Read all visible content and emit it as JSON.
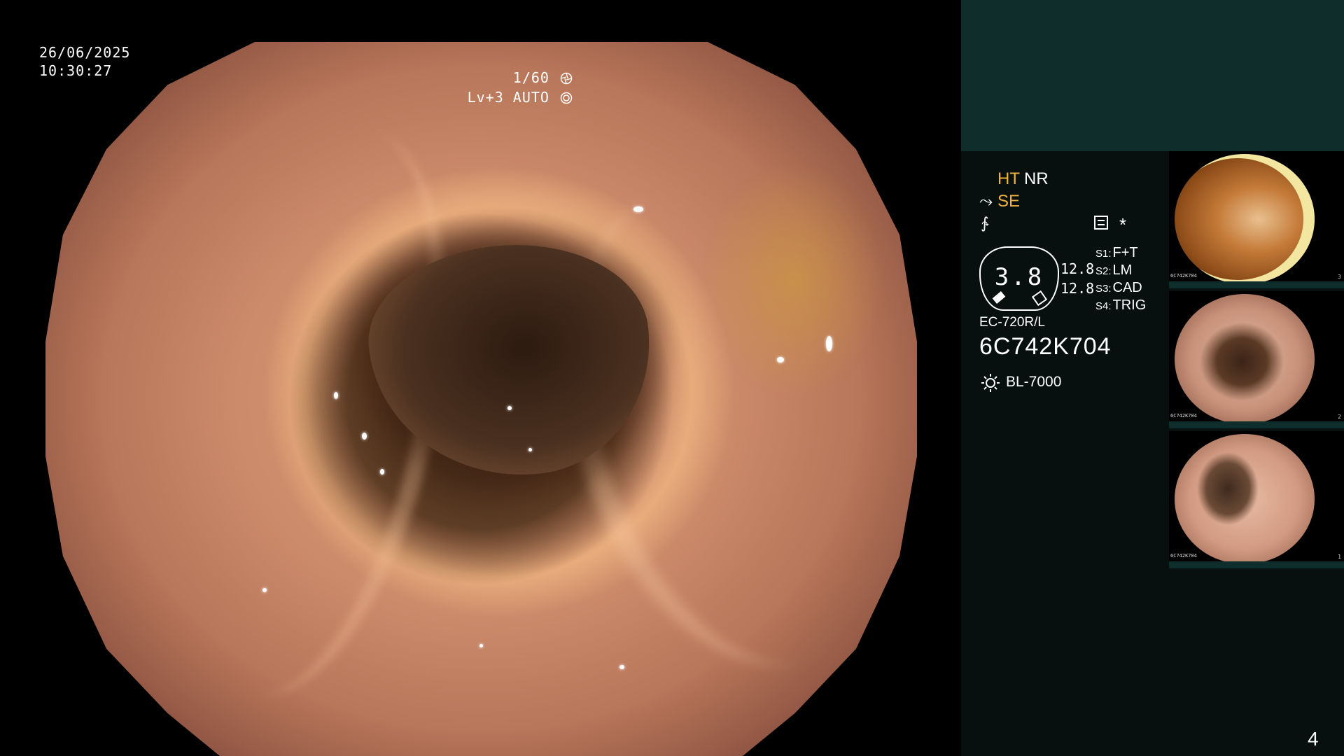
{
  "osd": {
    "date": "26/06/2025",
    "time": "10:30:27",
    "shutter": "1/60",
    "shutter_icon": "aperture-icon",
    "level": "Lv+3 AUTO",
    "level_icon": "iris-icon"
  },
  "panel": {
    "ht": "HT",
    "nr": "NR",
    "se": "SE",
    "se_icon": "structure-enhancement-icon",
    "freeze_icon": "freeze-icon",
    "menu_icon": "menu-list-icon",
    "star": "*",
    "gauge_value": "3.8",
    "values": [
      "12.8",
      "12.8"
    ],
    "switches": [
      {
        "key": "S1:",
        "value": "F+T"
      },
      {
        "key": "S2:",
        "value": "LM"
      },
      {
        "key": "S3:",
        "value": "CAD"
      },
      {
        "key": "S4:",
        "value": "TRIG"
      }
    ],
    "scope_model": "EC-720R/L",
    "scope_serial": "6C742K704",
    "light_icon": "light-source-icon",
    "light_source": "BL-7000",
    "accent_color": "#f2b23d",
    "panel_color": "#0f2d2b"
  },
  "thumbnails": [
    {
      "index": "3",
      "serial": "6C742K704"
    },
    {
      "index": "2",
      "serial": "6C742K704"
    },
    {
      "index": "1",
      "serial": "6C742K704"
    }
  ],
  "page_number": "4"
}
